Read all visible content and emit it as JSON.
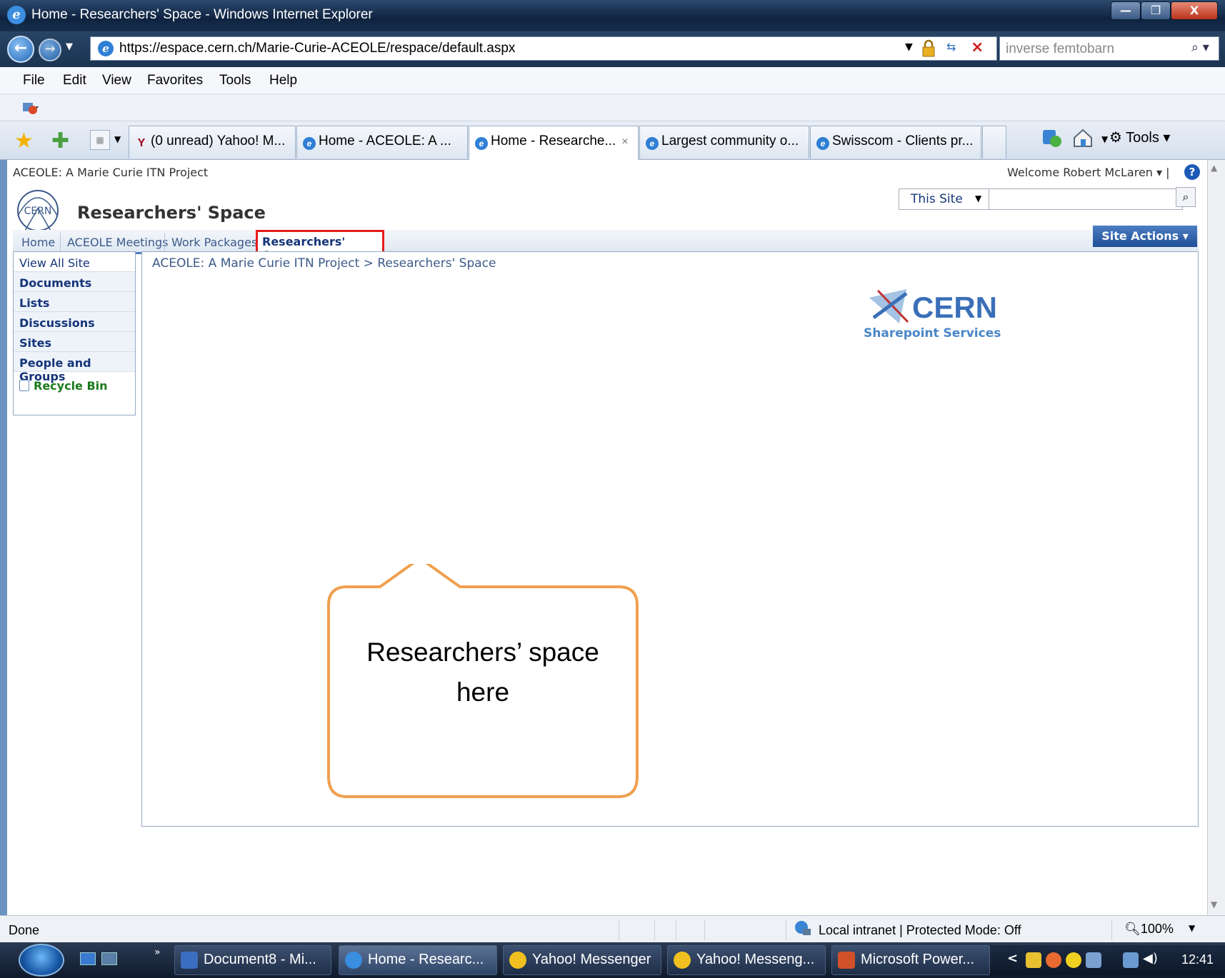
{
  "window": {
    "title": "Home - Researchers' Space - Windows Internet Explorer",
    "minimize_glyph": "—",
    "maximize_glyph": "❐",
    "close_glyph": "X"
  },
  "address": {
    "url": "https://espace.cern.ch/Marie-Curie-ACEOLE/respace/default.aspx",
    "search_value": "inverse femtobarn"
  },
  "menu": {
    "items": [
      "File",
      "Edit",
      "View",
      "Favorites",
      "Tools",
      "Help"
    ]
  },
  "tabs": {
    "items": [
      {
        "label": "(0 unread) Yahoo! M...",
        "icon": "yahoo-icon"
      },
      {
        "label": "Home - ACEOLE: A ...",
        "icon": "ie-icon"
      },
      {
        "label": "Home - Researche...",
        "icon": "ie-icon"
      },
      {
        "label": "Largest community o...",
        "icon": "ie-icon"
      },
      {
        "label": "Swisscom - Clients pr...",
        "icon": "ie-icon"
      }
    ],
    "tab_close_glyph": "×",
    "tools_label": "Tools ▾"
  },
  "site": {
    "breadcrumb_header": "ACEOLE: A Marie Curie ITN Project",
    "welcome": "Welcome Robert McLaren ▾  |",
    "help_glyph": "?",
    "logo_text": "CERN",
    "title": "Researchers' Space",
    "scope": "This Site",
    "search_glyph": "⌕",
    "top_nav": [
      "Home",
      "ACEOLE Meetings",
      "Work Packages"
    ],
    "top_nav_selected": "Researchers' Space",
    "site_actions": "Site Actions ▾"
  },
  "quick_launch": {
    "items": [
      "View All Site Content",
      "Documents",
      "Lists",
      "Discussions",
      "Sites",
      "People and Groups"
    ],
    "recycle_bin": "Recycle Bin"
  },
  "content": {
    "breadcrumb": "ACEOLE: A Marie Curie ITN Project > Researchers' Space",
    "cern_logo_title": "CERN",
    "cern_logo_subtitle": "Sharepoint Services"
  },
  "callout": {
    "line1": "Researchers’ space",
    "line2": "here",
    "border_color": "#f0a050"
  },
  "status": {
    "text": "Done",
    "zone": "Local intranet | Protected Mode: Off",
    "zoom": "100%"
  },
  "taskbar": {
    "items": [
      {
        "label": "Document8 - Mi...",
        "icon": "word-icon"
      },
      {
        "label": "Home - Researc...",
        "icon": "ie-icon"
      },
      {
        "label": "Yahoo! Messenger",
        "icon": "yahoo-messenger-icon"
      },
      {
        "label": "Yahoo! Messeng...",
        "icon": "yahoo-messenger-icon"
      },
      {
        "label": "Microsoft Power...",
        "icon": "powerpoint-icon"
      }
    ],
    "clock": "12:41"
  },
  "colors": {
    "selection_highlight": "#e81c1c",
    "link_blue": "#15357a"
  }
}
